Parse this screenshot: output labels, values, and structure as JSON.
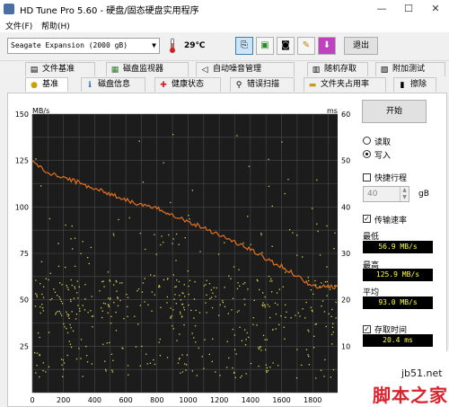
{
  "window": {
    "title": "HD Tune Pro 5.60 - 硬盘/固态硬盘实用程序",
    "minimize": "—",
    "maximize": "☐",
    "close": "✕"
  },
  "menu": [
    {
      "label": "文件(F)"
    },
    {
      "label": "帮助(H)"
    }
  ],
  "toolbar": {
    "drive": "Seagate Expansion (2000 gB)",
    "temperature": "29℃",
    "exit_label": "退出"
  },
  "tabs_top": [
    {
      "label": "文件基准",
      "icon": "file-benchmark-icon"
    },
    {
      "label": "磁盘监视器",
      "icon": "disk-monitor-icon"
    },
    {
      "label": "自动噪音管理",
      "icon": "speaker-icon"
    },
    {
      "label": "随机存取",
      "icon": "random-access-icon"
    },
    {
      "label": "附加测试",
      "icon": "extra-tests-icon"
    }
  ],
  "tabs_bottom": [
    {
      "label": "基准",
      "icon": "benchmark-icon",
      "selected": true
    },
    {
      "label": "磁盘信息",
      "icon": "disk-info-icon"
    },
    {
      "label": "健康状态",
      "icon": "health-icon"
    },
    {
      "label": "错误扫描",
      "icon": "error-scan-icon"
    },
    {
      "label": "文件夹占用率",
      "icon": "folder-usage-icon"
    },
    {
      "label": "擦除",
      "icon": "erase-icon"
    }
  ],
  "controls": {
    "start_label": "开始",
    "read_label": "读取",
    "write_label": "写入",
    "mode_selected": "write",
    "short_stroke_label": "快捷行程",
    "short_stroke_checked": false,
    "short_stroke_value": "40",
    "short_stroke_unit": "gB",
    "transfer_rate_label": "传输速率",
    "transfer_rate_checked": true,
    "min_label": "最低",
    "min_value": "56.9 MB/s",
    "max_label": "最高",
    "max_value": "125.9 MB/s",
    "avg_label": "平均",
    "avg_value": "93.0 MB/s",
    "access_time_label": "存取时间",
    "access_time_checked": true,
    "access_time_value": "20.4 ms"
  },
  "chart_data": {
    "type": "line",
    "y_left_unit": "MB/s",
    "y_right_unit": "ms",
    "y_left_ticks": [
      "150",
      "125",
      "100",
      "75",
      "50",
      "25"
    ],
    "y_right_ticks": [
      "60",
      "50",
      "40",
      "30",
      "20",
      "10"
    ],
    "x_ticks": [
      "0",
      "200",
      "400",
      "600",
      "800",
      "1000",
      "1200",
      "1400",
      "1600",
      "1800"
    ],
    "x_range": [
      0,
      1960
    ],
    "y_range": [
      0,
      150
    ],
    "grid": true,
    "series": [
      {
        "color": "#e07020",
        "x": [
          0,
          100,
          200,
          300,
          400,
          500,
          600,
          700,
          800,
          900,
          1000,
          1100,
          1200,
          1300,
          1400,
          1500,
          1600,
          1700,
          1800,
          1900,
          1960
        ],
        "values": [
          125,
          118,
          116,
          113,
          110,
          107,
          104,
          101,
          99,
          96,
          92,
          89,
          85,
          81,
          77,
          72,
          68,
          63,
          57,
          57,
          57
        ]
      }
    ],
    "scatter_color": "#d4d44a"
  },
  "watermark": {
    "url": "jb51.net",
    "name": "脚本之家"
  },
  "colors": {
    "chart_bg": "#1c1c1c",
    "grid": "#4a4a4a",
    "readout_text": "#ffff40"
  }
}
